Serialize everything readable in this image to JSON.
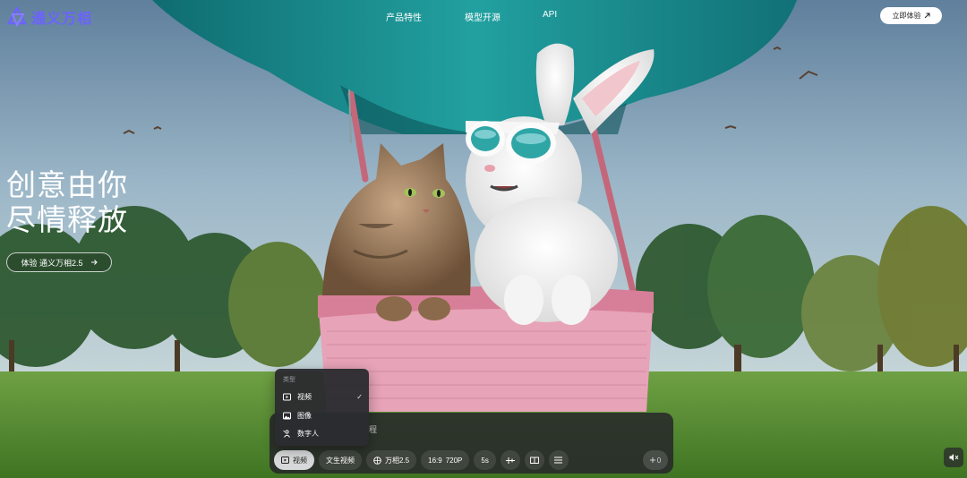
{
  "brand": {
    "name": "通义万相",
    "logo_icon": "wanxiang-logo-icon",
    "logo_color": "#6b63ff"
  },
  "nav": {
    "items": [
      {
        "label": "产品特性"
      },
      {
        "label": "模型开源"
      },
      {
        "label": "API"
      }
    ],
    "cta_label": "立即体验",
    "cta_icon": "arrow-up-right-icon"
  },
  "hero": {
    "line1": "创意由你",
    "line2": "尽情释放",
    "cta_label": "体验 通义万相2.5",
    "cta_icon": "arrow-right-icon"
  },
  "composer": {
    "prompt_hint_visible": "程",
    "toolbar": {
      "mode_label": "视频",
      "task_label": "文生视频",
      "model_label": "万相2.5",
      "ratio_label": "16:9",
      "resolution_label": "720P",
      "duration_label": "5s",
      "extra_icons": [
        "sliders-icon",
        "book-icon",
        "list-icon"
      ]
    },
    "send": {
      "label": "0",
      "icon": "plus-icon"
    }
  },
  "dropdown": {
    "header": "类型",
    "items": [
      {
        "label": "视频",
        "icon": "video-icon",
        "selected": true
      },
      {
        "label": "图像",
        "icon": "image-icon",
        "selected": false
      },
      {
        "label": "数字人",
        "icon": "digital-human-icon",
        "selected": false
      }
    ],
    "check_glyph": "✓"
  },
  "sound": {
    "icon": "speaker-icon",
    "muted": true
  },
  "colors": {
    "balloon": "#1d8a8a",
    "basket": "#e59fb4",
    "grass": "#4f8a2b",
    "sky": "#8fb1c4"
  }
}
